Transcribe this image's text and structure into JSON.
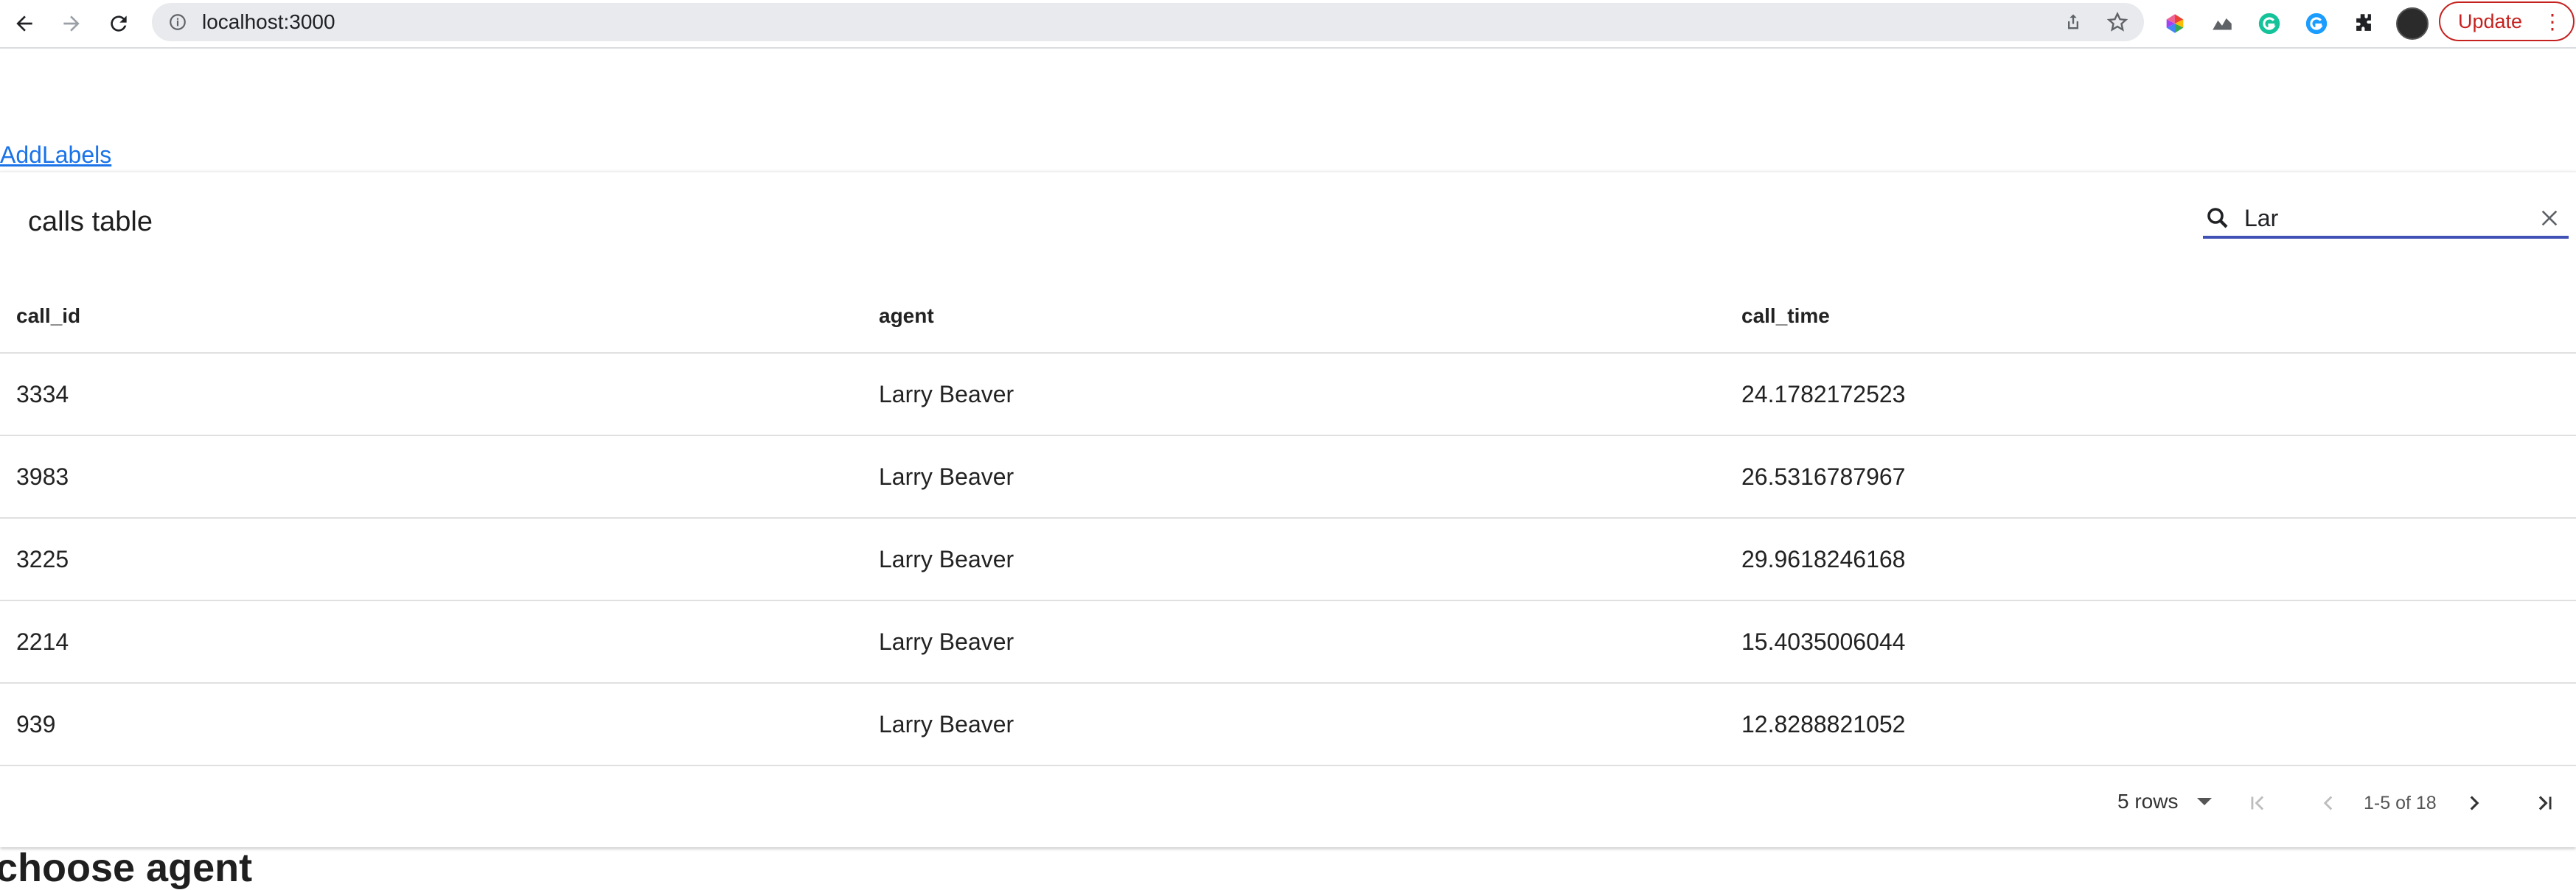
{
  "browser": {
    "url": "localhost:3000",
    "update_label": "Update",
    "menu_glyph": "⋮"
  },
  "page": {
    "add_labels_link": "AddLabels",
    "section_heading": "choose agent"
  },
  "table": {
    "title": "calls table",
    "search_value": "Lar",
    "columns": [
      "call_id",
      "agent",
      "call_time"
    ],
    "rows": [
      [
        "3334",
        "Larry Beaver",
        "24.1782172523"
      ],
      [
        "3983",
        "Larry Beaver",
        "26.5316787967"
      ],
      [
        "3225",
        "Larry Beaver",
        "29.9618246168"
      ],
      [
        "2214",
        "Larry Beaver",
        "15.4035006044"
      ],
      [
        "939",
        "Larry Beaver",
        "12.8288821052"
      ]
    ],
    "pagination": {
      "rows_per_page_label": "5 rows",
      "range_label": "1-5 of 18"
    }
  },
  "colors": {
    "link": "#1a73e8",
    "search_underline": "#3f51b5",
    "update_red": "#c5221f"
  }
}
